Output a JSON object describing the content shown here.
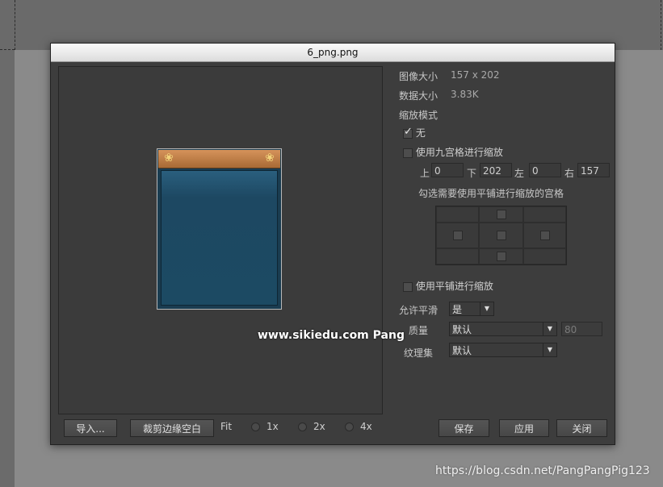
{
  "dialog": {
    "title": "6_png.png"
  },
  "info": {
    "image_size_label": "图像大小",
    "image_size_value": "157 x 202",
    "data_size_label": "数据大小",
    "data_size_value": "3.83K",
    "scale_mode_label": "缩放模式"
  },
  "scale_options": {
    "none_label": "无",
    "none_checked": true,
    "nine_grid_label": "使用九宫格进行缩放",
    "nine_grid_checked": false
  },
  "nine_grid": {
    "top_label": "上",
    "top_value": "0",
    "bottom_label": "下",
    "bottom_value": "202",
    "left_label": "左",
    "left_value": "0",
    "right_label": "右",
    "right_value": "157",
    "tile_hint": "勾选需要使用平铺进行缩放的宫格"
  },
  "tile": {
    "label": "使用平铺进行缩放",
    "checked": false
  },
  "smoothing": {
    "label": "允许平滑",
    "value": "是"
  },
  "quality": {
    "label": "质量",
    "value": "默认",
    "number_placeholder": "80"
  },
  "texture_set": {
    "label": "纹理集",
    "value": "默认"
  },
  "zoom": {
    "options": [
      "Fit",
      "1x",
      "2x",
      "4x"
    ],
    "selected": "Fit"
  },
  "buttons": {
    "import": "导入...",
    "trim": "裁剪边缘空白",
    "save": "保存",
    "apply": "应用",
    "close": "关闭"
  },
  "watermarks": {
    "overlay": "www.sikiedu.com Pang",
    "csdn": "https://blog.csdn.net/PangPangPig123"
  },
  "colors": {
    "dialog_bg": "#3d3d3d",
    "sprite_header": "#c27f45",
    "sprite_body": "#1d4862"
  },
  "icons": {
    "sprite_ornament": "❀"
  }
}
